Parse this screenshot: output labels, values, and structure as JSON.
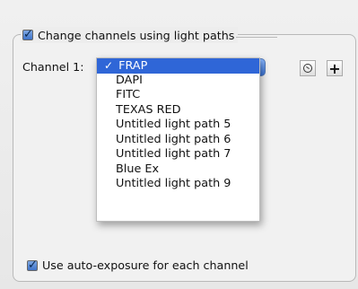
{
  "group": {
    "checkbox_label": "Change channels using light paths",
    "checked": true
  },
  "channel": {
    "label": "Channel 1:",
    "selected": "FRAP",
    "options": [
      "FRAP",
      "DAPI",
      "FITC",
      "TEXAS RED",
      "Untitled light path 5",
      "Untitled light path 6",
      "Untitled light path 7",
      "Blue Ex",
      "Untitled light path 9"
    ]
  },
  "auto_exposure": {
    "label": "Use auto-exposure for each channel",
    "checked": true
  },
  "icons": {
    "check": "✓",
    "checkbox": "checkmark",
    "popup_arrows": "up-down-arrows",
    "add": "+",
    "reset": "circle-reset"
  },
  "colors": {
    "selection": "#2f66d7",
    "checkbox": "#3e73c9"
  }
}
